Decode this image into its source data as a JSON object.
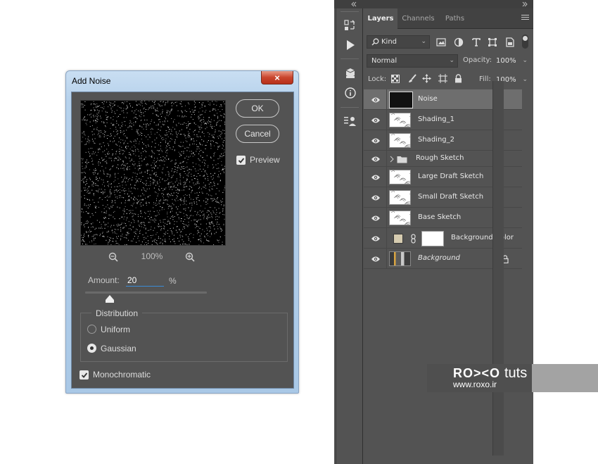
{
  "dialog": {
    "title": "Add Noise",
    "close_glyph": "×",
    "ok_label": "OK",
    "cancel_label": "Cancel",
    "preview_label": "Preview",
    "preview_checked": true,
    "zoom_level": "100%",
    "amount_label": "Amount:",
    "amount_value": "20",
    "amount_unit": "%",
    "amount_slider_fraction": 0.2,
    "distribution_label": "Distribution",
    "distribution_options": [
      {
        "label": "Uniform",
        "selected": false
      },
      {
        "label": "Gaussian",
        "selected": true
      }
    ],
    "monochromatic_label": "Monochromatic",
    "monochromatic_checked": true
  },
  "toolbar": {
    "icons": [
      "history-icon",
      "play-action-icon",
      "3d-object-icon",
      "info-icon",
      "properties-icon"
    ]
  },
  "panel": {
    "tabs": [
      {
        "label": "Layers",
        "active": true
      },
      {
        "label": "Channels",
        "active": false
      },
      {
        "label": "Paths",
        "active": false
      }
    ],
    "filter_kind": "Kind",
    "blend_mode": "Normal",
    "opacity_label": "Opacity:",
    "opacity_value": "100%",
    "lock_label": "Lock:",
    "fill_label": "Fill:",
    "fill_value": "100%",
    "layers": [
      {
        "name": "Noise",
        "selected": true,
        "type": "noise"
      },
      {
        "name": "Shading_1",
        "selected": false,
        "type": "sketch"
      },
      {
        "name": "Shading_2",
        "selected": false,
        "type": "sketch"
      },
      {
        "name": "Rough Sketch",
        "selected": false,
        "type": "group"
      },
      {
        "name": "Large Draft Sketch",
        "selected": false,
        "type": "sketch"
      },
      {
        "name": "Small Draft Sketch",
        "selected": false,
        "type": "sketch"
      },
      {
        "name": "Base Sketch",
        "selected": false,
        "type": "sketch"
      },
      {
        "name": "Background Color",
        "selected": false,
        "type": "fill"
      },
      {
        "name": "Background",
        "selected": false,
        "type": "background",
        "locked": true
      }
    ],
    "colors": {
      "fill_swatch": "#d6ccb0"
    }
  },
  "watermark": {
    "logo": "RO><O",
    "tuts": "tuts",
    "url": "www.roxo.ir"
  }
}
